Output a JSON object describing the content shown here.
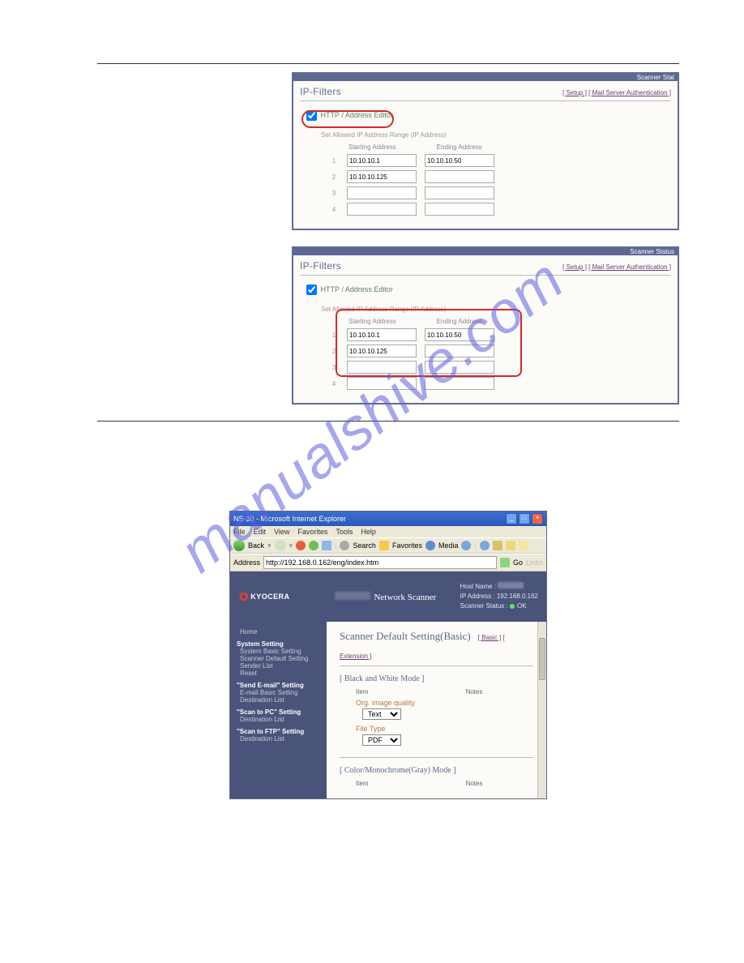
{
  "watermark": "manualshive.com",
  "sections": {
    "s1": {
      "banner": "Scanner Stat",
      "ipf_title": "IP-Filters",
      "links_setup": "[ Setup ]",
      "links_mailauth": "[ Mail Server Authentication ]",
      "chk_label": "HTTP / Address Editor",
      "subtitle": "Set Allowed IP Address Range (IP Address)",
      "hdr_start": "Starting Address",
      "hdr_end": "Ending Address",
      "rows": [
        {
          "idx": "1",
          "start": "10.10.10.1",
          "end": "10.10.10.50"
        },
        {
          "idx": "2",
          "start": "10.10.10.125",
          "end": ""
        },
        {
          "idx": "3",
          "start": "",
          "end": ""
        },
        {
          "idx": "4",
          "start": "",
          "end": ""
        }
      ]
    },
    "s2": {
      "banner": "Scanner Status",
      "ipf_title": "IP-Filters",
      "links_setup": "[ Setup ]",
      "links_mailauth": "[ Mail Server Authentication ]",
      "chk_label": "HTTP / Address Editor",
      "subtitle": "Set Allowed IP Address Range (IP Address)",
      "hdr_start": "Starting Address",
      "hdr_end": "Ending Address",
      "rows": [
        {
          "idx": "1",
          "start": "10.10.10.1",
          "end": "10.10.10.50"
        },
        {
          "idx": "2",
          "start": "10.10.10.125",
          "end": ""
        },
        {
          "idx": "3",
          "start": "",
          "end": ""
        },
        {
          "idx": "4",
          "start": "",
          "end": ""
        }
      ]
    },
    "br": {
      "window_title": "NS-30 - Microsoft Internet Explorer",
      "menu": {
        "file": "File",
        "edit": "Edit",
        "view": "View",
        "fav": "Favorites",
        "tools": "Tools",
        "help": "Help"
      },
      "tb_back": "Back",
      "tb_search": "Search",
      "tb_fav": "Favorites",
      "tb_media": "Media",
      "addr_label": "Address",
      "addr_url": "http://192.168.0.162/eng/index.htm",
      "go_label": "Go",
      "links_label": "Links",
      "brand": "KYOCERA",
      "header_title": "Network Scanner",
      "hr_host": "Host Name :",
      "hr_ip": "IP Address : 192.168.0.162",
      "hr_status": "Scanner Status :",
      "hr_ok": "OK",
      "nav": {
        "home": "Home",
        "sys_title": "System Setting",
        "sys_items": {
          "a": "System Basic Setting",
          "b": "Scanner Default Setting",
          "c": "Sender List",
          "d": "Reset"
        },
        "mail_title": "\"Send E-mail\" Setting",
        "mail_items": {
          "a": "E-mail Basic Setting",
          "b": "Destination List"
        },
        "pc_title": "\"Scan to PC\" Setting",
        "pc_items": {
          "a": "Destination List"
        },
        "ftp_title": "\"Scan to FTP\" Setting",
        "ftp_items": {
          "a": "Destination List"
        }
      },
      "main": {
        "title": "Scanner Default Setting(Basic)",
        "link_basic": "[ Basic ]",
        "link_ext": "[ Extension ]",
        "bw_title": "[ Black and White Mode ]",
        "col_item": "Item",
        "col_notes": "Notes",
        "f1_label": "Org. image quality",
        "f1_value": "Text",
        "f2_label": "File Type",
        "f2_value": "PDF",
        "color_title": "[ Color/Monochrome(Gray) Mode ]"
      }
    }
  }
}
